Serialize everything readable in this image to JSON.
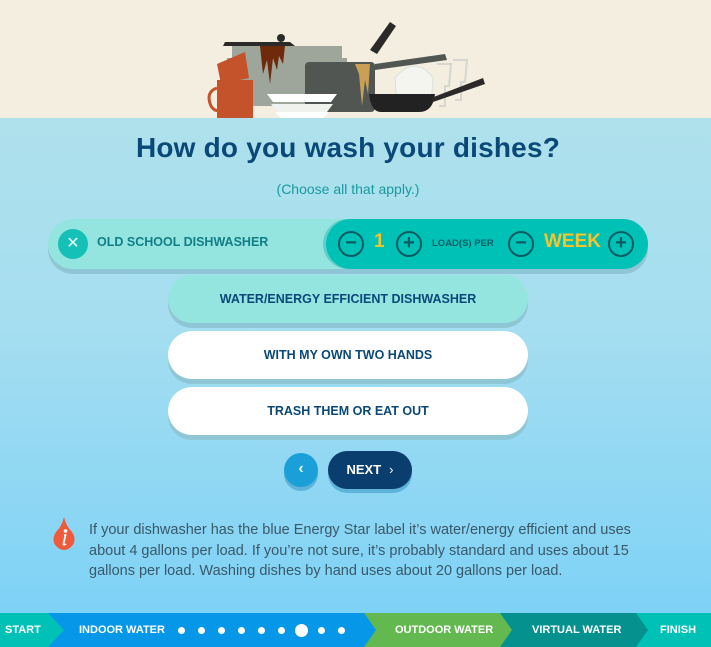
{
  "page": {
    "title": "How do you wash your dishes?",
    "subtitle": "(Choose all that apply.)"
  },
  "selected_option": {
    "remove_icon": "close-icon",
    "label": "OLD SCHOOL DISHWASHER",
    "quantity": {
      "decrement_icon": "minus-circle-icon",
      "value": "1",
      "increment_icon": "plus-circle-icon",
      "unit_label": "LOAD(S) PER",
      "period_value": "WEEK"
    }
  },
  "options": [
    {
      "label": "WATER/ENERGY EFFICIENT DISHWASHER",
      "state": "hover"
    },
    {
      "label": "WITH MY OWN TWO HANDS",
      "state": "default"
    },
    {
      "label": "TRASH THEM OR EAT OUT",
      "state": "default"
    }
  ],
  "navigation": {
    "back_icon": "chevron-left-icon",
    "next_label": "NEXT",
    "next_icon": "chevron-right-icon"
  },
  "info": {
    "icon": "info-drop-icon",
    "text": "If your dishwasher has the blue Energy Star label it’s water/energy efficient and uses about 4 gallons per load. If you’re not sure, it’s probably standard and uses about 15 gallons per load. Washing dishes by hand uses about 20 gallons per load."
  },
  "progress": {
    "sections": [
      {
        "label": "START",
        "color": "#00c1b6"
      },
      {
        "label": "INDOOR WATER",
        "color": "#0797e8"
      },
      {
        "label": "OUTDOOR WATER",
        "color": "#63b84f"
      },
      {
        "label": "VIRTUAL WATER",
        "color": "#05928e"
      },
      {
        "label": "FINISH",
        "color": "#00c1b6"
      }
    ],
    "indoor_steps_total": 9,
    "indoor_current_step": 7
  },
  "colors": {
    "title": "#0a4878",
    "accent_teal": "#00c1b6",
    "highlight_yellow": "#f8c42b",
    "next_button": "#0a3e6e",
    "info_icon": "#ef5a3c"
  }
}
